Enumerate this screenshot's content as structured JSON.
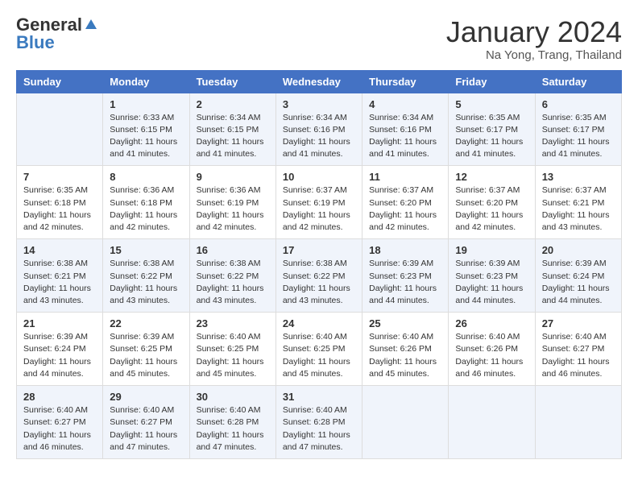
{
  "logo": {
    "general": "General",
    "blue": "Blue"
  },
  "title": "January 2024",
  "location": "Na Yong, Trang, Thailand",
  "weekdays": [
    "Sunday",
    "Monday",
    "Tuesday",
    "Wednesday",
    "Thursday",
    "Friday",
    "Saturday"
  ],
  "weeks": [
    [
      {
        "day": "",
        "info": ""
      },
      {
        "day": "1",
        "info": "Sunrise: 6:33 AM\nSunset: 6:15 PM\nDaylight: 11 hours and 41 minutes."
      },
      {
        "day": "2",
        "info": "Sunrise: 6:34 AM\nSunset: 6:15 PM\nDaylight: 11 hours and 41 minutes."
      },
      {
        "day": "3",
        "info": "Sunrise: 6:34 AM\nSunset: 6:16 PM\nDaylight: 11 hours and 41 minutes."
      },
      {
        "day": "4",
        "info": "Sunrise: 6:34 AM\nSunset: 6:16 PM\nDaylight: 11 hours and 41 minutes."
      },
      {
        "day": "5",
        "info": "Sunrise: 6:35 AM\nSunset: 6:17 PM\nDaylight: 11 hours and 41 minutes."
      },
      {
        "day": "6",
        "info": "Sunrise: 6:35 AM\nSunset: 6:17 PM\nDaylight: 11 hours and 41 minutes."
      }
    ],
    [
      {
        "day": "7",
        "info": "Sunrise: 6:35 AM\nSunset: 6:18 PM\nDaylight: 11 hours and 42 minutes."
      },
      {
        "day": "8",
        "info": "Sunrise: 6:36 AM\nSunset: 6:18 PM\nDaylight: 11 hours and 42 minutes."
      },
      {
        "day": "9",
        "info": "Sunrise: 6:36 AM\nSunset: 6:19 PM\nDaylight: 11 hours and 42 minutes."
      },
      {
        "day": "10",
        "info": "Sunrise: 6:37 AM\nSunset: 6:19 PM\nDaylight: 11 hours and 42 minutes."
      },
      {
        "day": "11",
        "info": "Sunrise: 6:37 AM\nSunset: 6:20 PM\nDaylight: 11 hours and 42 minutes."
      },
      {
        "day": "12",
        "info": "Sunrise: 6:37 AM\nSunset: 6:20 PM\nDaylight: 11 hours and 42 minutes."
      },
      {
        "day": "13",
        "info": "Sunrise: 6:37 AM\nSunset: 6:21 PM\nDaylight: 11 hours and 43 minutes."
      }
    ],
    [
      {
        "day": "14",
        "info": "Sunrise: 6:38 AM\nSunset: 6:21 PM\nDaylight: 11 hours and 43 minutes."
      },
      {
        "day": "15",
        "info": "Sunrise: 6:38 AM\nSunset: 6:22 PM\nDaylight: 11 hours and 43 minutes."
      },
      {
        "day": "16",
        "info": "Sunrise: 6:38 AM\nSunset: 6:22 PM\nDaylight: 11 hours and 43 minutes."
      },
      {
        "day": "17",
        "info": "Sunrise: 6:38 AM\nSunset: 6:22 PM\nDaylight: 11 hours and 43 minutes."
      },
      {
        "day": "18",
        "info": "Sunrise: 6:39 AM\nSunset: 6:23 PM\nDaylight: 11 hours and 44 minutes."
      },
      {
        "day": "19",
        "info": "Sunrise: 6:39 AM\nSunset: 6:23 PM\nDaylight: 11 hours and 44 minutes."
      },
      {
        "day": "20",
        "info": "Sunrise: 6:39 AM\nSunset: 6:24 PM\nDaylight: 11 hours and 44 minutes."
      }
    ],
    [
      {
        "day": "21",
        "info": "Sunrise: 6:39 AM\nSunset: 6:24 PM\nDaylight: 11 hours and 44 minutes."
      },
      {
        "day": "22",
        "info": "Sunrise: 6:39 AM\nSunset: 6:25 PM\nDaylight: 11 hours and 45 minutes."
      },
      {
        "day": "23",
        "info": "Sunrise: 6:40 AM\nSunset: 6:25 PM\nDaylight: 11 hours and 45 minutes."
      },
      {
        "day": "24",
        "info": "Sunrise: 6:40 AM\nSunset: 6:25 PM\nDaylight: 11 hours and 45 minutes."
      },
      {
        "day": "25",
        "info": "Sunrise: 6:40 AM\nSunset: 6:26 PM\nDaylight: 11 hours and 45 minutes."
      },
      {
        "day": "26",
        "info": "Sunrise: 6:40 AM\nSunset: 6:26 PM\nDaylight: 11 hours and 46 minutes."
      },
      {
        "day": "27",
        "info": "Sunrise: 6:40 AM\nSunset: 6:27 PM\nDaylight: 11 hours and 46 minutes."
      }
    ],
    [
      {
        "day": "28",
        "info": "Sunrise: 6:40 AM\nSunset: 6:27 PM\nDaylight: 11 hours and 46 minutes."
      },
      {
        "day": "29",
        "info": "Sunrise: 6:40 AM\nSunset: 6:27 PM\nDaylight: 11 hours and 47 minutes."
      },
      {
        "day": "30",
        "info": "Sunrise: 6:40 AM\nSunset: 6:28 PM\nDaylight: 11 hours and 47 minutes."
      },
      {
        "day": "31",
        "info": "Sunrise: 6:40 AM\nSunset: 6:28 PM\nDaylight: 11 hours and 47 minutes."
      },
      {
        "day": "",
        "info": ""
      },
      {
        "day": "",
        "info": ""
      },
      {
        "day": "",
        "info": ""
      }
    ]
  ]
}
